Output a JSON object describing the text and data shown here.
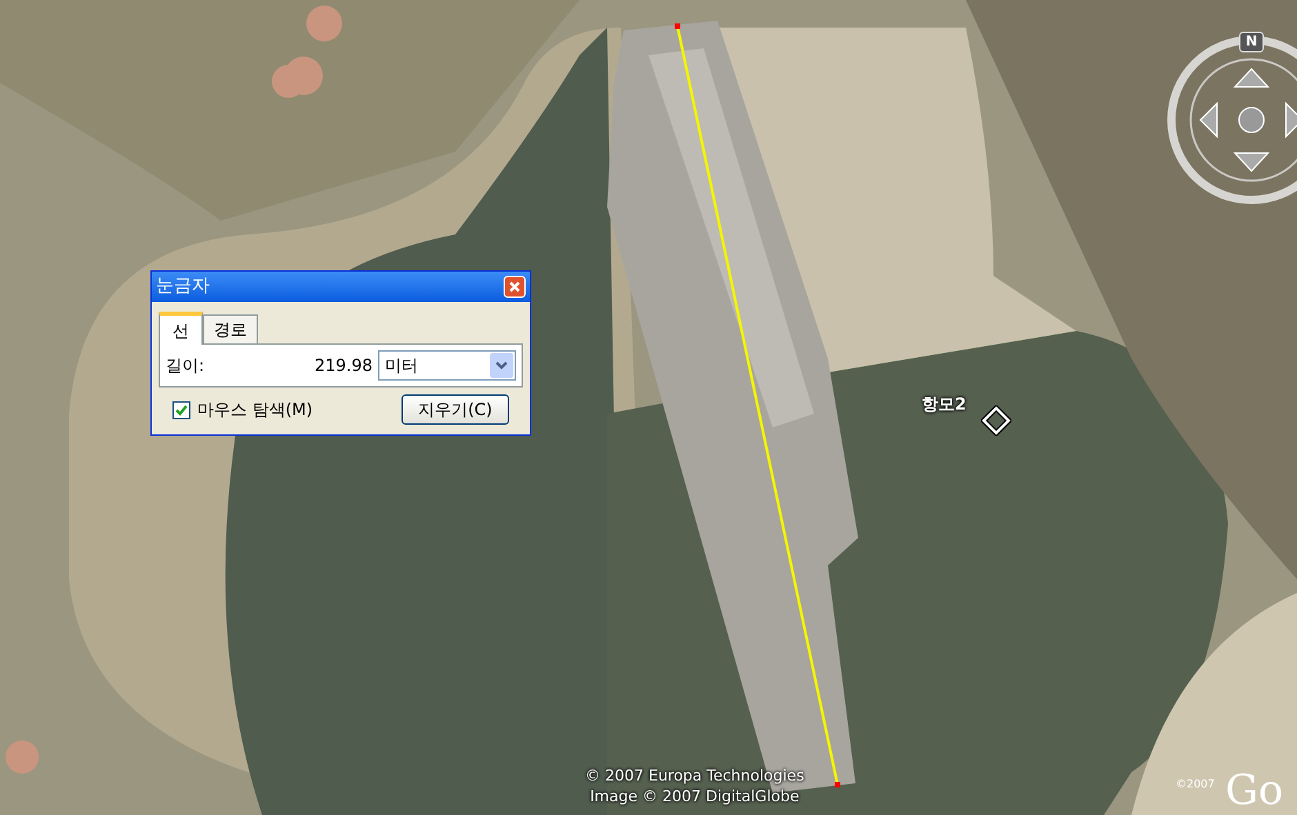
{
  "ruler_dialog": {
    "title": "눈금자",
    "tabs": [
      {
        "label": "선",
        "selected": true
      },
      {
        "label": "경로",
        "selected": false
      }
    ],
    "length_label": "길이:",
    "length_value": "219.98",
    "unit": "미터",
    "mouse_navigation": {
      "label": "마우스 탐색(M)",
      "checked": true
    },
    "clear_button": "지우기(C)"
  },
  "map": {
    "placemark": {
      "label": "항모2"
    },
    "compass": {
      "north_label": "N"
    },
    "attribution": [
      "© 2007 Europa Technologies",
      "Image © 2007 DigitalGlobe"
    ],
    "logo_copyright": "©2007",
    "logo": "Go"
  }
}
